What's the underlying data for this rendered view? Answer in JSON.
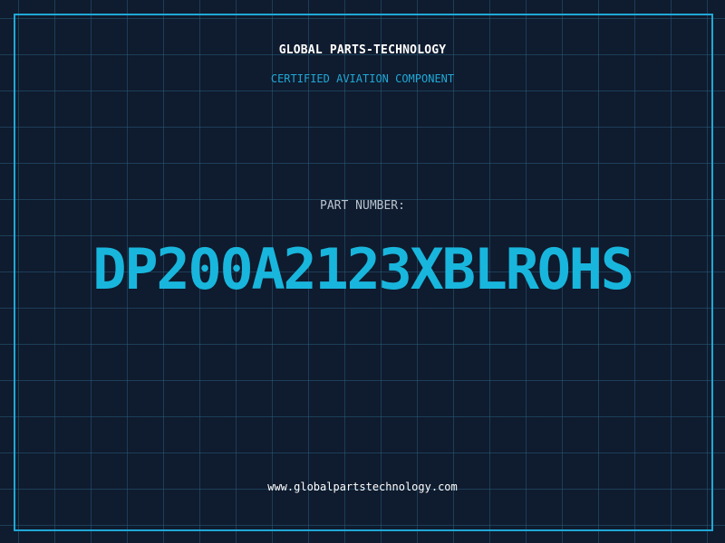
{
  "brand": {
    "name": "GLOBAL PARTS-TECHNOLOGY",
    "tagline": "CERTIFIED AVIATION COMPONENT"
  },
  "part": {
    "label": "PART NUMBER:",
    "number": "DP200A2123XBLROHS"
  },
  "footer": {
    "website": "www.globalpartstechnology.com"
  },
  "colors": {
    "background": "#0f1b2e",
    "grid": "#265c7a",
    "accent": "#1fa8d6",
    "part_number": "#18b6dd",
    "text": "#ffffff"
  }
}
